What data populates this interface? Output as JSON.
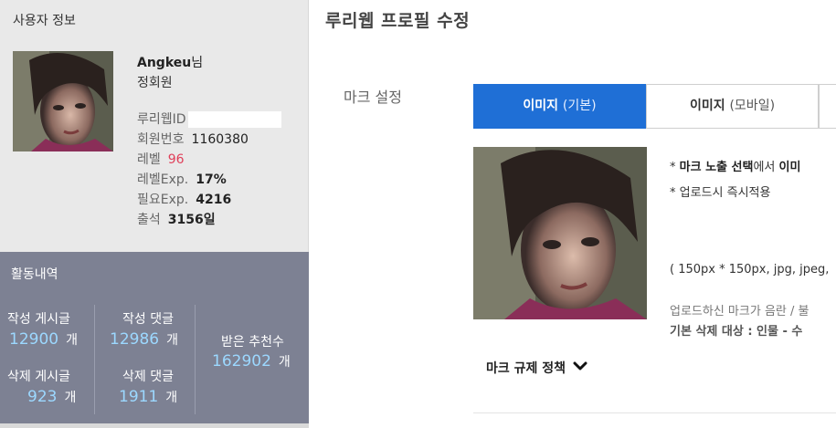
{
  "sidebar": {
    "user_info_title": "사용자 정보",
    "user": {
      "name": "Angkeu",
      "name_suffix": "님",
      "grade": "정회원",
      "rows": {
        "id_label": "루리웹ID",
        "member_no_label": "회원번호",
        "member_no": "1160380",
        "level_label": "레벨",
        "level": "96",
        "level_exp_label": "레벨Exp.",
        "level_exp": "17%",
        "need_exp_label": "필요Exp.",
        "need_exp": "4216",
        "attendance_label": "출석",
        "attendance": "3156일"
      }
    },
    "activity": {
      "title": "활동내역",
      "posts_label": "작성 게시글",
      "posts": "12900",
      "comments_label": "작성 댓글",
      "comments": "12986",
      "deleted_posts_label": "삭제 게시글",
      "deleted_posts": "923",
      "deleted_comments_label": "삭제 댓글",
      "deleted_comments": "1911",
      "recommends_label": "받은 추천수",
      "recommends": "162902",
      "unit": "개"
    }
  },
  "main": {
    "title": "루리웹 프로필 수정",
    "field_label": "마크 설정",
    "tabs": [
      {
        "label": "이미지",
        "paren": "(기본)"
      },
      {
        "label": "이미지",
        "paren": "(모바일)"
      }
    ],
    "notes": {
      "line1_prefix": "* ",
      "line1_bold": "마크 노출 선택",
      "line1_mid": "에서 ",
      "line1_tail": "이미",
      "line2": "* 업로드시 즉시적용",
      "line3": "( 150px * 150px, jpg, jpeg,",
      "line4": "업로드하신 마크가 음란 / 불",
      "line5": "기본 삭제 대상 : 인물 - 수"
    },
    "policy_label": "마크 규제 정책"
  },
  "colors": {
    "active_tab": "#1f6fd6",
    "activity_bg": "#7d8193",
    "stat_number": "#9cd8ff",
    "level_value": "#e0405a"
  }
}
